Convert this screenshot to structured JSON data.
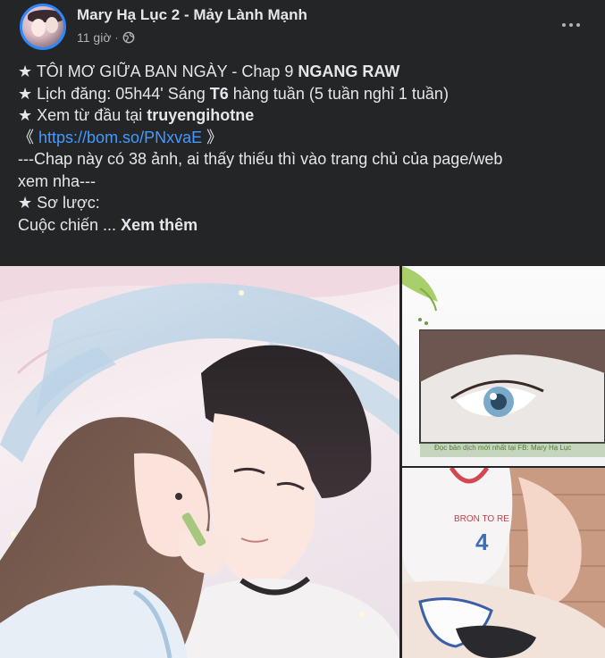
{
  "author": {
    "name": "Mary Hạ Lục 2 - Mảy Lành Mạnh"
  },
  "meta": {
    "time": "11 giờ",
    "separator": "·",
    "privacy_icon": "globe-icon"
  },
  "post": {
    "line1_prefix": "★ TÔI MƠ GIỮA BAN NGÀY - Chap 9 ",
    "line1_bold": "NGANG RAW",
    "line2_prefix": "★ Lịch đăng: 05h44' Sáng ",
    "line2_bold": "T6",
    "line2_suffix": " hàng tuần (5 tuần nghỉ 1 tuần)",
    "line3_prefix": "★ Xem từ đầu tại ",
    "line3_bold": "truyengihotne",
    "link_open": "《 ",
    "link_url": "https://bom.so/PNxvaE",
    "link_close": " 》",
    "line5": "---Chap này có 38 ảnh, ai thấy thiếu thì vào trang chủ của page/web",
    "line6": "xem nha---",
    "line7": "★ Sơ lược:",
    "line8_prefix": "Cuộc chiến ... ",
    "see_more": "Xem thêm"
  },
  "images": {
    "watermark": "Đọc bản dịch mới nhất tại FB: Mary Hạ Lục",
    "jersey_text": "BRON TO RE",
    "jersey_number": "4"
  }
}
